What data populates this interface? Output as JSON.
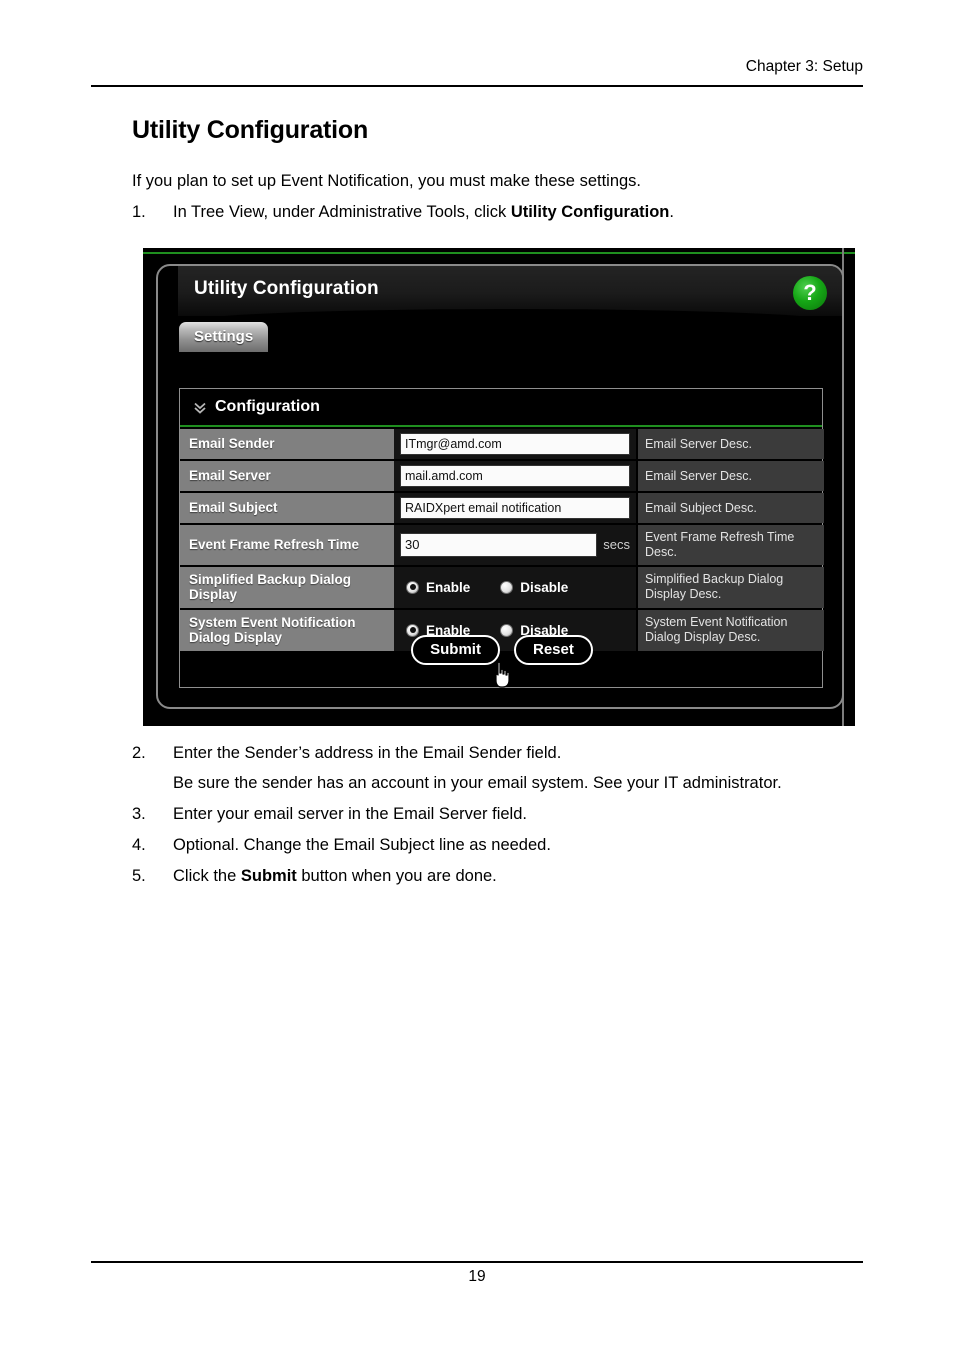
{
  "document": {
    "running_header": "Chapter 3: Setup",
    "page_number": "19",
    "heading": "Utility Configuration",
    "intro": "If you plan to set up Event Notification, you must make these settings.",
    "steps_before_figure": [
      {
        "num": "1.",
        "text_parts": [
          "In Tree View, under Administrative Tools, click ",
          "Utility Configuration",
          "."
        ]
      }
    ],
    "steps_after_figure": [
      {
        "num": "2.",
        "text": "Enter the Sender’s address in the Email Sender field."
      },
      {
        "num": "3.",
        "text": "Enter your email server in the Email Server field."
      },
      {
        "num": "4.",
        "text": "Optional. Change the Email Subject line as needed."
      },
      {
        "num": "5.",
        "text_parts": [
          "Click the ",
          "Submit",
          " button when you are done."
        ]
      }
    ],
    "substep_note": "Be sure the sender has an account in your email system. See your IT administrator."
  },
  "figure": {
    "title": "Utility Configuration",
    "help_icon_label": "?",
    "tabs": [
      {
        "label": "Settings",
        "active": true
      }
    ],
    "card": {
      "expander_icon": "chevron-double-down-icon",
      "title": "Configuration",
      "accent_color": "#1f8f1f",
      "rows": [
        {
          "label": "Email Sender",
          "type": "text",
          "value": "ITmgr@amd.com",
          "desc": "Email Server Desc."
        },
        {
          "label": "Email Server",
          "type": "text",
          "value": "mail.amd.com",
          "desc": "Email Server Desc."
        },
        {
          "label": "Email Subject",
          "type": "text",
          "value": "RAIDXpert email notification",
          "desc": "Email Subject Desc."
        },
        {
          "label": "Event Frame Refresh Time",
          "type": "select",
          "value": "30",
          "unit": "secs",
          "desc": "Event Frame Refresh Time Desc."
        },
        {
          "label": "Simplified Backup Dialog Display",
          "type": "radio",
          "options": [
            "Enable",
            "Disable"
          ],
          "selected": "Enable",
          "desc": "Simplified Backup Dialog Display Desc."
        },
        {
          "label": "System Event Notification Dialog Display",
          "type": "radio",
          "options": [
            "Enable",
            "Disable"
          ],
          "selected": "Enable",
          "desc": "System Event Notification Dialog Display Desc."
        }
      ]
    },
    "buttons": {
      "submit": "Submit",
      "reset": "Reset"
    },
    "cursor": {
      "type": "pointing-hand",
      "over": "Submit"
    }
  }
}
